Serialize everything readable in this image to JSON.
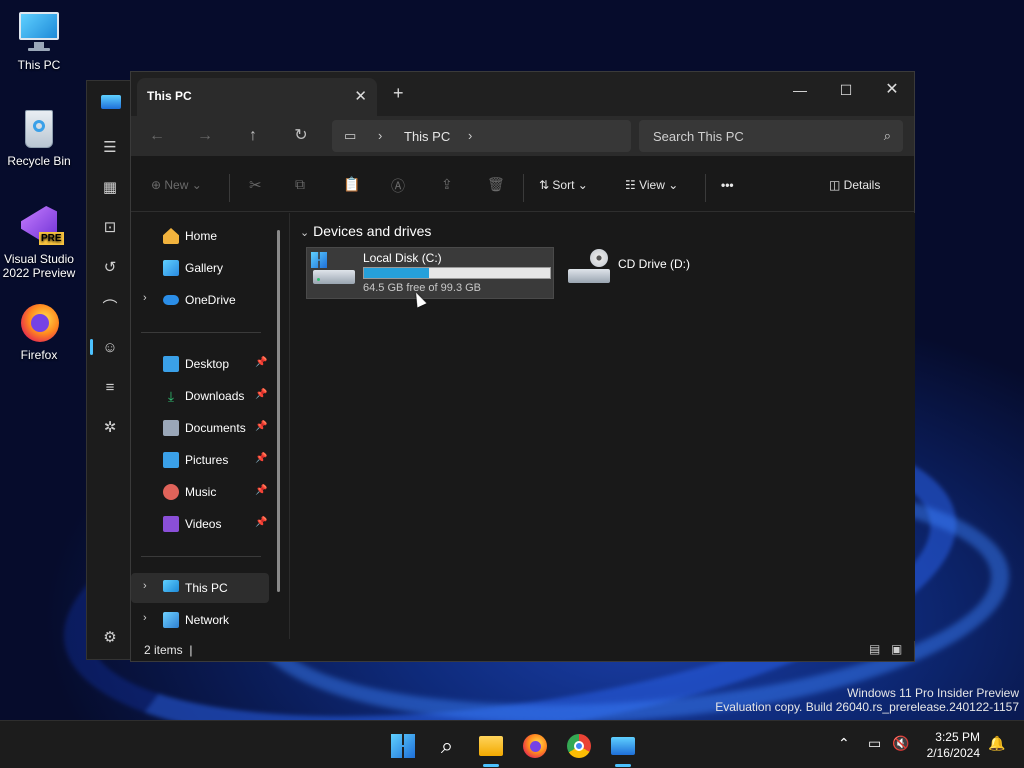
{
  "desktop": {
    "icons": [
      {
        "label": "This PC",
        "icon": "monitor-icon"
      },
      {
        "label": "Recycle Bin",
        "icon": "recycle-bin-icon"
      },
      {
        "label": "Visual Studio 2022 Preview",
        "icon": "visual-studio-icon",
        "badge": "PRE"
      },
      {
        "label": "Firefox",
        "icon": "firefox-icon"
      }
    ]
  },
  "explorer": {
    "tab_title": "This PC",
    "address": {
      "crumb": "This PC"
    },
    "search": {
      "placeholder": "Search This PC"
    },
    "commands": {
      "new": "New",
      "sort": "Sort",
      "view": "View",
      "more": "•••",
      "details": "Details"
    },
    "nav": {
      "home": "Home",
      "gallery": "Gallery",
      "onedrive": "OneDrive",
      "quick": [
        {
          "label": "Desktop",
          "color": "#3aa0e8"
        },
        {
          "label": "Downloads",
          "color": "#2fbf71"
        },
        {
          "label": "Documents",
          "color": "#9aa7b8"
        },
        {
          "label": "Pictures",
          "color": "#3aa0e8"
        },
        {
          "label": "Music",
          "color": "#e0635a"
        },
        {
          "label": "Videos",
          "color": "#8a4fd8"
        }
      ],
      "this_pc": "This PC",
      "network": "Network"
    },
    "content": {
      "group": "Devices and drives",
      "drives": [
        {
          "name": "Local Disk (C:)",
          "free_text": "64.5 GB free of 99.3 GB",
          "used_fraction": 0.35
        },
        {
          "name": "CD Drive (D:)"
        }
      ]
    },
    "status": {
      "count": "2 items"
    }
  },
  "watermark": {
    "line1": "Windows 11 Pro Insider Preview",
    "line2": "Evaluation copy. Build 26040.rs_prerelease.240122-1157"
  },
  "taskbar": {
    "time": "3:25 PM",
    "date": "2/16/2024"
  },
  "colors": {
    "accent": "#26a0da",
    "taskbar_indicator": "#4cc2ff"
  }
}
